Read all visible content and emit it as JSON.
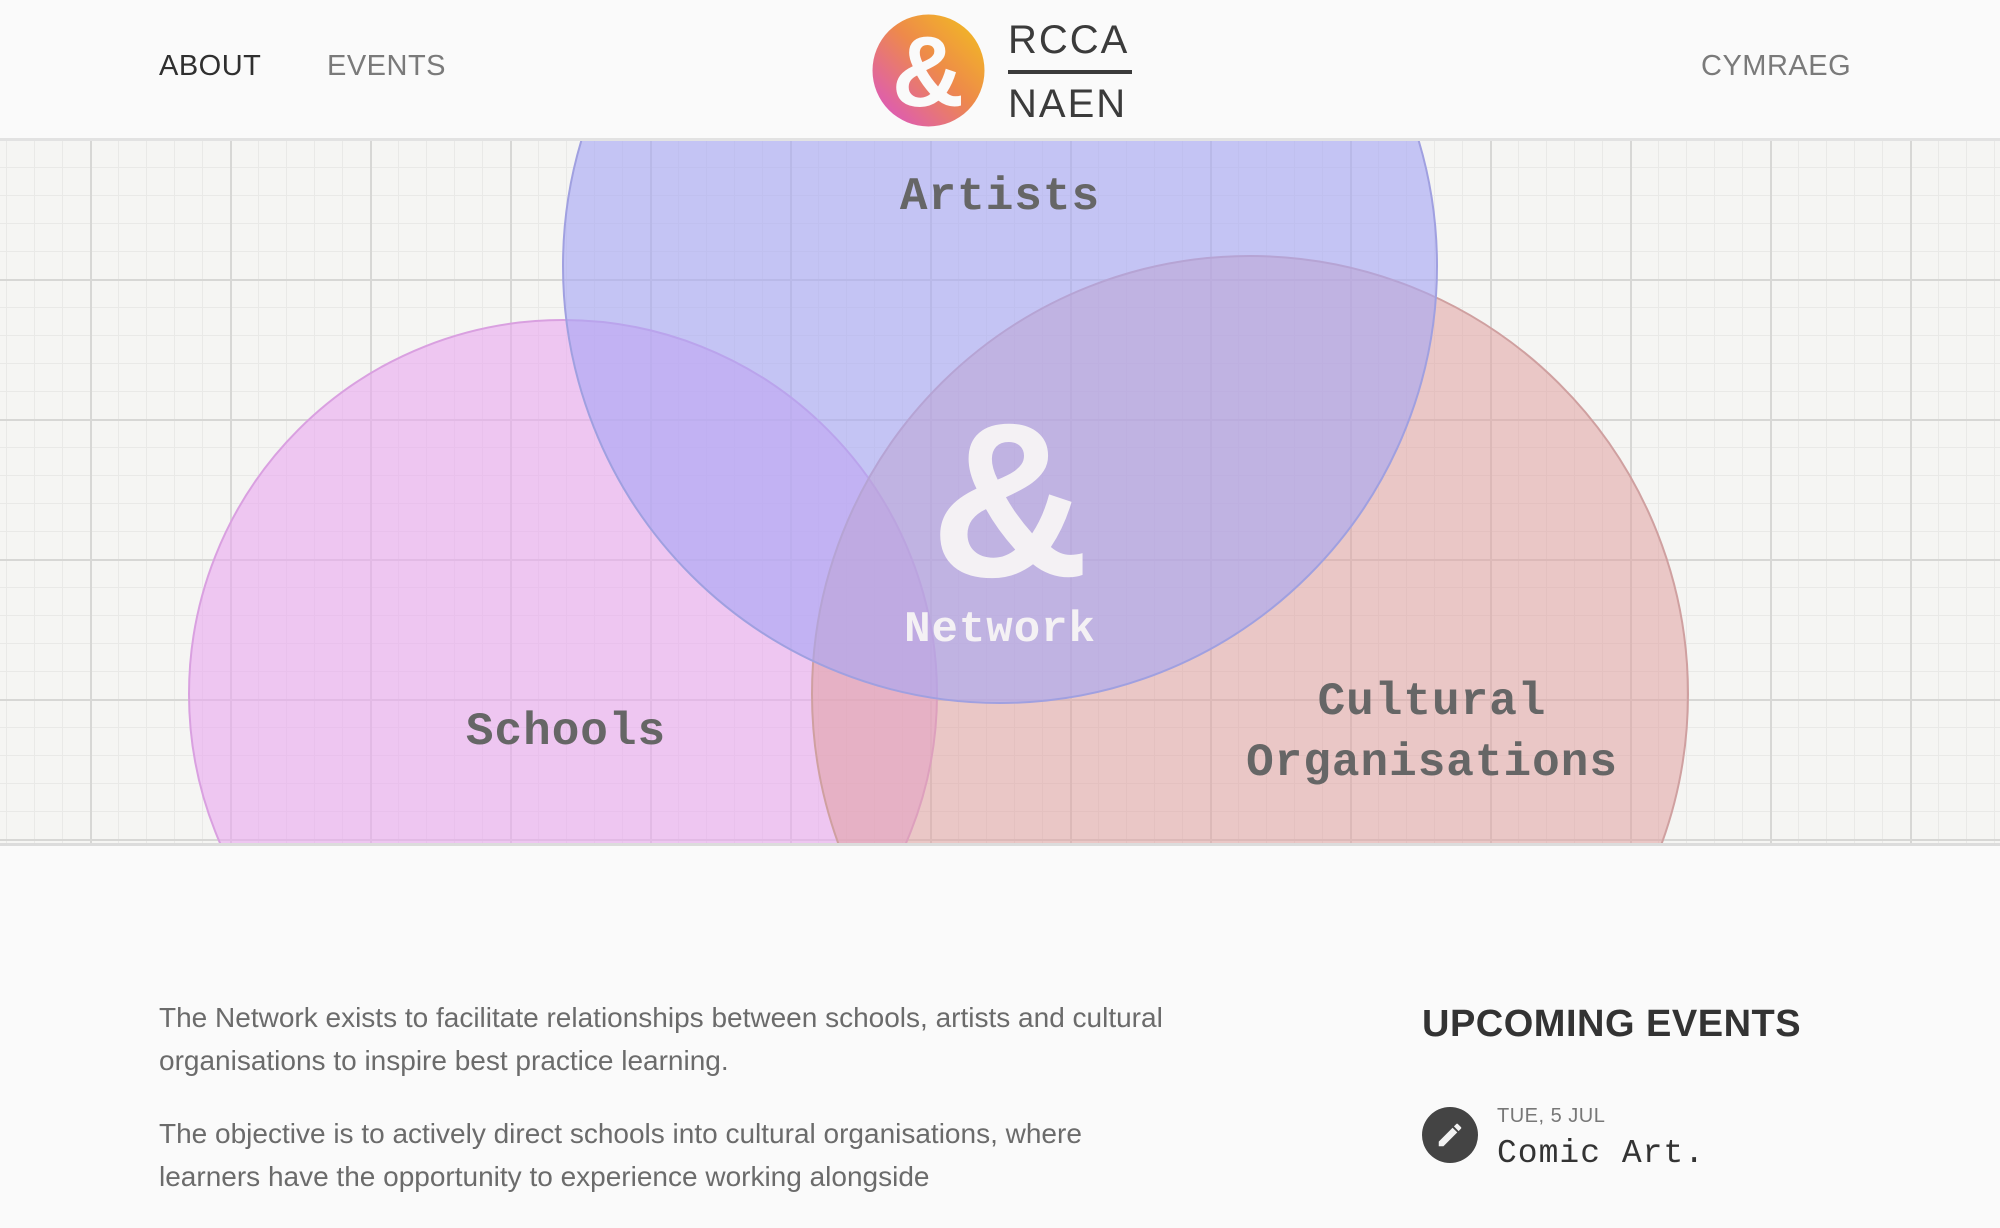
{
  "header": {
    "nav": [
      {
        "label": "ABOUT",
        "active": true
      },
      {
        "label": "EVENTS",
        "active": false
      }
    ],
    "logo": {
      "line1": "RCCA",
      "line2": "NAEN",
      "mark": "&"
    },
    "language_label": "CYMRAEG"
  },
  "hero": {
    "circles": [
      {
        "label": "Artists",
        "color": "#aaaaf5"
      },
      {
        "label": "Schools",
        "color": "#e9a6f0"
      },
      {
        "label_line1": "Cultural",
        "label_line2": "Organisations",
        "color": "#e3a6a6"
      }
    ],
    "center": {
      "symbol": "&",
      "label": "Network"
    }
  },
  "intro": {
    "paragraphs": [
      "The Network exists to facilitate relationships between schools, artists and cultural organisations to inspire best practice learning.",
      "The objective is to actively direct schools into cultural organisations, where learners have the opportunity to experience working alongside"
    ]
  },
  "events": {
    "heading": "UPCOMING EVENTS",
    "items": [
      {
        "date": "TUE, 5 JUL",
        "title": "Comic Art.",
        "icon": "pencil-icon"
      }
    ]
  }
}
